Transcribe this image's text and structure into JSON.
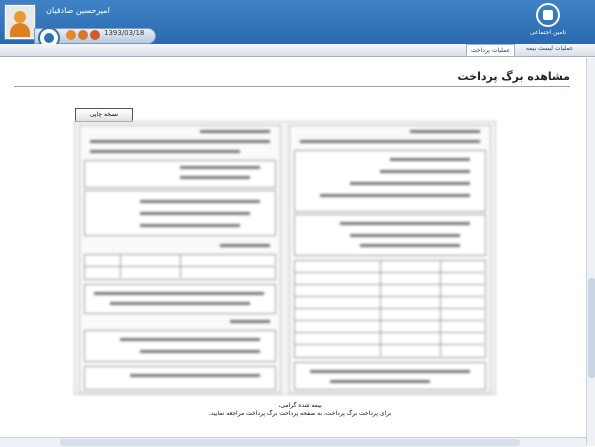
{
  "header": {
    "username": "امیرحسین صادقیان",
    "date": "1393/03/18",
    "brand": "تامین اجتماعی"
  },
  "menu": {
    "items": [
      {
        "label": "عملیات لیست بیمه"
      },
      {
        "label": "عملیات پرداخت"
      }
    ]
  },
  "main": {
    "title": "مشاهده برگ پرداخت",
    "print_label": "نسخه چاپی",
    "footer_line1": "بیمه شده گرامی،",
    "footer_line2": "برای پرداخت برگ پرداخت، به صفحه پرداخت برگ پرداخت مراجعه نمایید."
  },
  "colors": {
    "header": "#3f83c6",
    "accent": "#2a6aae",
    "title_rule": "#8da7c6"
  }
}
